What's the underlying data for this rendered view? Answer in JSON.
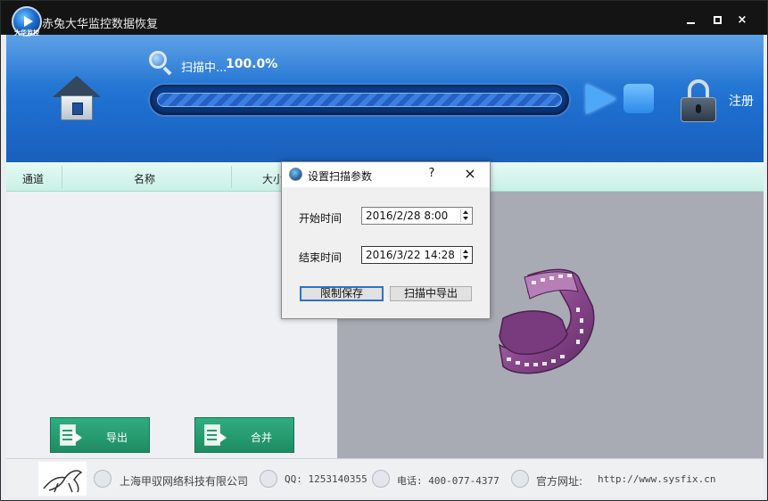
{
  "app": {
    "title": "赤兔大华监控数据恢复",
    "logo_tag": "大华监控"
  },
  "window_controls": {
    "close_glyph": "×"
  },
  "header": {
    "scan_status": "扫描中...",
    "scan_percent": "100.0%",
    "progress": 1.0,
    "register_label": "注册",
    "accent_color": "#1e6fcf"
  },
  "table": {
    "columns": [
      "通道",
      "名称",
      "大小"
    ]
  },
  "actions": {
    "export_label": "导出",
    "merge_label": "合并"
  },
  "dialog": {
    "title": "设置扫描参数",
    "help": "?",
    "close": "×",
    "start_label": "开始时间",
    "start_value": "2016/2/28 8:00",
    "end_label": "结束时间",
    "end_value": "2016/3/22 14:28",
    "limit_save_button": "限制保存",
    "export_during_scan_button": "扫描中导出"
  },
  "footer": {
    "company": "上海甲驭网络科技有限公司",
    "qq": "QQ: 1253140355",
    "phone": "电话: 400-077-4377",
    "site_label": "官方网址:",
    "site_url": "http://www.sysfix.cn"
  },
  "icons": {
    "home": "home-icon",
    "search": "search-icon",
    "play": "play-icon",
    "stop": "stop-icon",
    "lock": "lock-icon",
    "film": "film-reel-icon"
  }
}
